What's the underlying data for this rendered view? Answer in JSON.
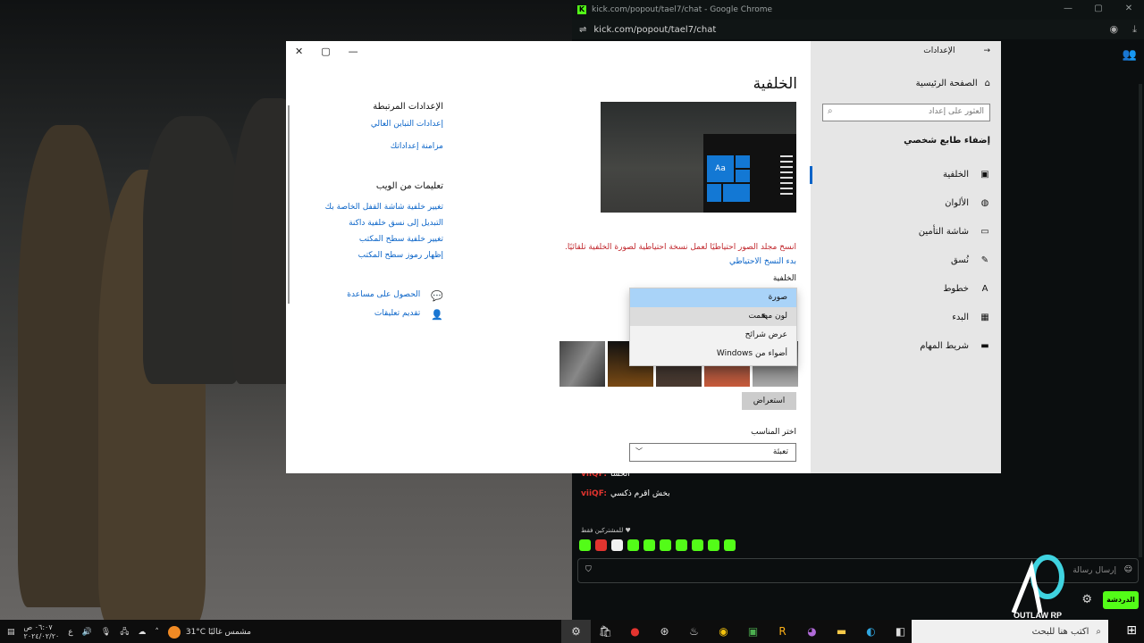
{
  "chrome": {
    "title": "kick.com/popout/tael7/chat - Google Chrome",
    "url": "kick.com/popout/tael7/chat",
    "chat": {
      "messages": [
        {
          "user": "viiQF:",
          "text": "الحسا"
        },
        {
          "user": "viiQF:",
          "text": "بخش اقرم ذكسي"
        }
      ],
      "sub_only": "للمشتركين فقط",
      "input_placeholder": "إرسال رسالة",
      "send_label": "الدردشة"
    },
    "watermark": "OUTLAW RP"
  },
  "settings": {
    "nav_title": "الإعدادات",
    "home": "الصفحة الرئيسية",
    "search_placeholder": "العثور على إعداد",
    "section": "إضفاء طابع شخصي",
    "items": [
      {
        "label": "الخلفية",
        "icon": "picture-icon"
      },
      {
        "label": "الألوان",
        "icon": "palette-icon"
      },
      {
        "label": "شاشة التأمين",
        "icon": "lock-screen-icon"
      },
      {
        "label": "نُسق",
        "icon": "brush-icon"
      },
      {
        "label": "خطوط",
        "icon": "font-icon"
      },
      {
        "label": "البدء",
        "icon": "start-icon"
      },
      {
        "label": "شريط المهام",
        "icon": "taskbar-icon"
      }
    ],
    "page_title": "الخلفية",
    "preview_text": "Aa",
    "warning": "انسخ مجلد الصور احتياطيًا لعمل نسخة احتياطية لصورة الخلفية تلقائيًا.",
    "backup_link": "بدء النسخ الاحتياطي",
    "background_label": "الخلفية",
    "dropdown": [
      "صورة",
      "لون مصمت",
      "عرض شرائح",
      "أضواء من Windows"
    ],
    "browse": "استعراض",
    "fit_label": "اختر المناسب",
    "fit_value": "تعبئة",
    "related_title": "الإعدادات المرتبطة",
    "related_links": [
      "إعدادات التباين العالي",
      "مزامنة إعداداتك"
    ],
    "web_title": "تعليمات من الويب",
    "web_links": [
      "تغيير خلفية شاشة القفل الخاصة بك",
      "التبديل إلى نسق خلفية داكنة",
      "تغيير خلفية سطح المكتب",
      "إظهار رموز سطح المكتب"
    ],
    "help": [
      "الحصول على مساعدة",
      "تقديم تعليقات"
    ]
  },
  "taskbar": {
    "time": "٠٦:٠٧ ص",
    "date": "٢٠٢٤/٠٢/٢٠",
    "lang": "ع",
    "weather": "31°C مشمس غالبًا",
    "search": "اكتب هنا للبحث"
  }
}
